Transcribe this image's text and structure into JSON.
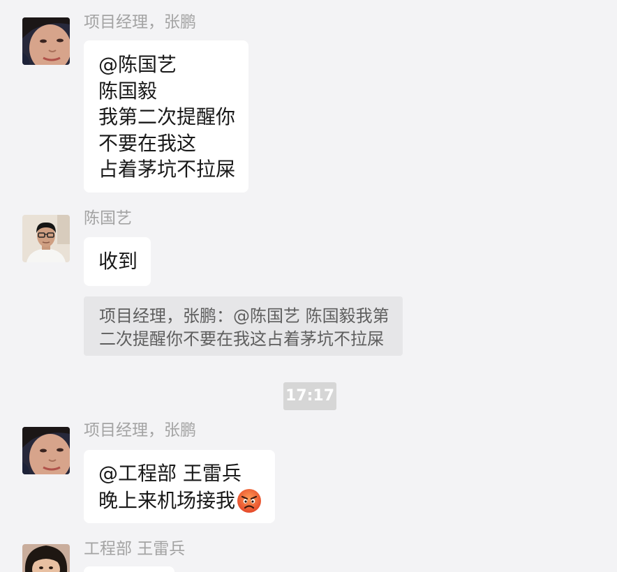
{
  "theme": {
    "bg": "#f3f3f5",
    "bubble": "#ffffff",
    "text": "#191919",
    "name": "#a3a3a3",
    "quote-bg": "#e6e6e8",
    "quote-text": "#5e5e5e",
    "time-bg": "#d6d6d6",
    "time-text": "#ffffff"
  },
  "messages": [
    {
      "sender": "项目经理，张鹏",
      "avatar": "person-photo-avatar",
      "lines": [
        "@陈国艺",
        "陈国毅",
        "我第二次提醒你",
        "不要在我这",
        "占着茅坑不拉屎"
      ]
    },
    {
      "sender": "陈国艺",
      "avatar": "person-photo-avatar",
      "lines": [
        "收到"
      ],
      "quote": [
        "项目经理，张鹏：@陈国艺 陈国毅我第",
        "二次提醒你不要在我这占着茅坑不拉屎"
      ]
    },
    {
      "sender": "项目经理，张鹏",
      "avatar": "person-photo-avatar",
      "lines": [
        "@工程部 王雷兵",
        "晚上来机场接我"
      ],
      "emoji": "angry-face-emoji"
    },
    {
      "sender": "工程部 王雷兵",
      "avatar": "person-photo-avatar"
    }
  ],
  "time_divider": "17:17"
}
